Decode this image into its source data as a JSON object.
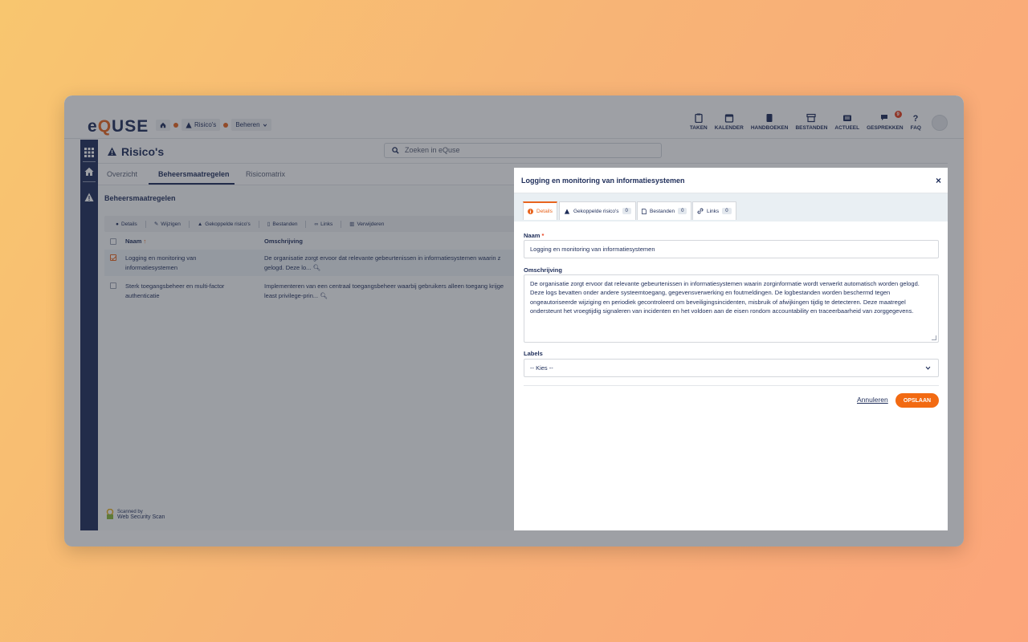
{
  "app": {
    "logo": {
      "pre": "e",
      "q": "Q",
      "post": "USE"
    },
    "breadcrumbs": [
      "Risico's",
      "Beheren"
    ],
    "topnav": [
      {
        "label": "TAKEN",
        "icon": "clipboard-icon"
      },
      {
        "label": "KALENDER",
        "icon": "calendar-icon"
      },
      {
        "label": "HANDBOEKEN",
        "icon": "book-icon"
      },
      {
        "label": "BESTANDEN",
        "icon": "archive-icon"
      },
      {
        "label": "ACTUEEL",
        "icon": "news-icon"
      },
      {
        "label": "GESPREKKEN",
        "icon": "chat-icon",
        "badge": "9"
      },
      {
        "label": "FAQ",
        "icon": "question-icon"
      }
    ]
  },
  "page": {
    "title": "Risico's",
    "search_placeholder": "Zoeken in eQuse",
    "tabs": [
      "Overzicht",
      "Beheersmaatregelen",
      "Risicomatrix"
    ],
    "section_title": "Beheersmaatregelen",
    "toolbar": [
      "Details",
      "Wijzigen",
      "Gekoppelde risico's",
      "Bestanden",
      "Links",
      "Verwijderen"
    ],
    "columns": [
      "Naam",
      "Omschrijving"
    ],
    "rows": [
      {
        "name_l1": "Logging en monitoring van",
        "name_l2": "informatiesystemen",
        "desc_l1": "De organisatie zorgt ervoor dat relevante gebeurtenissen in informatiesystemen waarin z",
        "desc_l2": "gelogd. Deze lo...",
        "selected": true
      },
      {
        "name_l1": "Sterk toegangsbeheer en multi-factor",
        "name_l2": "authenticatie",
        "desc_l1": "Implementeren van een centraal toegangsbeheer waarbij gebruikers alleen toegang krijge",
        "desc_l2": "least privilege-prin...",
        "selected": false
      }
    ],
    "footer_badge": {
      "line1": "Scanned by",
      "line2": "Web Security Scan"
    }
  },
  "modal": {
    "title": "Logging en monitoring van informatiesystemen",
    "close": "×",
    "tabs": [
      {
        "label": "Details"
      },
      {
        "label": "Gekoppelde risico's",
        "count": "0"
      },
      {
        "label": "Bestanden",
        "count": "0"
      },
      {
        "label": "Links",
        "count": "0"
      }
    ],
    "naam_label": "Naam",
    "required": "*",
    "naam_value": "Logging en monitoring van informatiesystemen",
    "omschrijving_label": "Omschrijving",
    "omschrijving_value": "De organisatie zorgt ervoor dat relevante gebeurtenissen in informatiesystemen waarin zorginformatie wordt verwerkt automatisch worden gelogd. Deze logs bevatten onder andere systeemtoegang, gegevensverwerking en foutmeldingen. De logbestanden worden beschermd tegen ongeautoriseerde wijziging en periodiek gecontroleerd om beveiligingsincidenten, misbruik of afwijkingen tijdig te detecteren. Deze maatregel ondersteunt het vroegtijdig signaleren van incidenten en het voldoen aan de eisen rondom accountability en traceerbaarheid van zorggegevens.",
    "labels_label": "Labels",
    "labels_value": "-- Kies --",
    "cancel": "Annuleren",
    "save": "OPSLAAN"
  },
  "colors": {
    "navy": "#1e2d59",
    "accent": "#f26a12",
    "badge": "#e8411e"
  }
}
